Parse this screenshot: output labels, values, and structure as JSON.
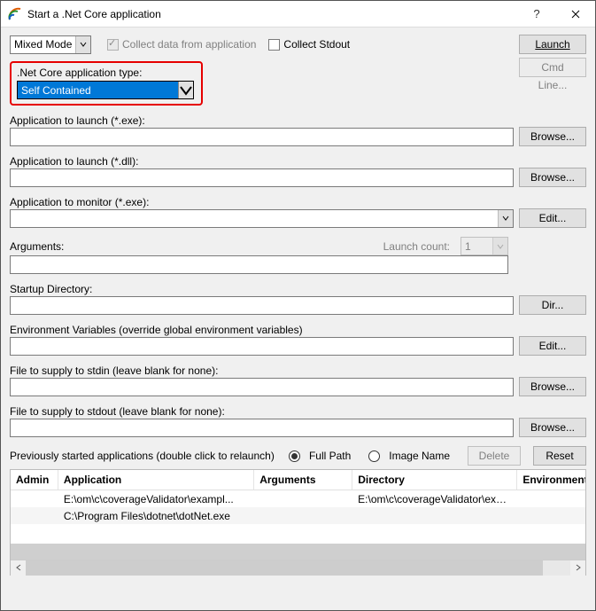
{
  "window": {
    "title": "Start a .Net Core application"
  },
  "toolbar": {
    "mode_label": "Mixed Mode",
    "collect_data_label": "Collect data from application",
    "collect_stdout_label": "Collect Stdout",
    "launch_label": "Launch",
    "cmdline_label": "Cmd Line..."
  },
  "apptype": {
    "label": ".Net Core application type:",
    "value": "Self Contained"
  },
  "fields": {
    "app_exe_label": "Application to launch (*.exe):",
    "app_dll_label": "Application to launch (*.dll):",
    "app_monitor_label": "Application to monitor (*.exe):",
    "arguments_label": "Arguments:",
    "launch_count_label": "Launch count:",
    "launch_count_value": "1",
    "startup_dir_label": "Startup Directory:",
    "env_vars_label": "Environment Variables (override global environment variables)",
    "stdin_label": "File to supply to stdin (leave blank for none):",
    "stdout_label": "File to supply to stdout (leave blank for none):"
  },
  "buttons": {
    "browse": "Browse...",
    "edit": "Edit...",
    "dir": "Dir...",
    "delete": "Delete",
    "reset": "Reset"
  },
  "previous": {
    "label": "Previously started applications (double click to relaunch)",
    "full_path_label": "Full Path",
    "image_name_label": "Image Name",
    "headers": {
      "admin": "Admin",
      "application": "Application",
      "arguments": "Arguments",
      "directory": "Directory",
      "environment": "Environment"
    },
    "rows": [
      {
        "admin": "",
        "application": "E:\\om\\c\\coverageValidator\\exampl...",
        "arguments": "",
        "directory": "E:\\om\\c\\coverageValidator\\exampl...",
        "environment": ""
      },
      {
        "admin": "",
        "application": "C:\\Program Files\\dotnet\\dotNet.exe",
        "arguments": "",
        "directory": "",
        "environment": ""
      }
    ]
  }
}
